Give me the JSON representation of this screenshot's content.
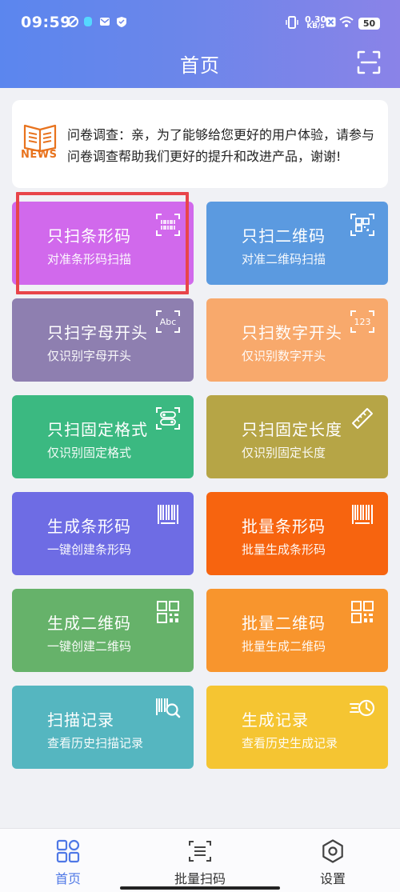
{
  "status_bar": {
    "time": "09:59",
    "network_speed_value": "0.30",
    "network_speed_unit": "KB/s",
    "battery": "50"
  },
  "header": {
    "title": "首页",
    "scan_icon": "scan-frame-icon"
  },
  "notice": {
    "icon_label": "NEWS",
    "text": "问卷调查：亲，为了能够给您更好的用户体验，请参与问卷调查帮助我们更好的提升和改进产品，谢谢!"
  },
  "cards": [
    {
      "title": "只扫条形码",
      "subtitle": "对准条形码扫描",
      "color": "#d169ec",
      "icon": "barcode-scan-icon"
    },
    {
      "title": "只扫二维码",
      "subtitle": "对准二维码扫描",
      "color": "#5b9ae0",
      "icon": "qrcode-scan-icon"
    },
    {
      "title": "只扫字母开头",
      "subtitle": "仅识别字母开头",
      "color": "#8e7fb0",
      "icon": "abc-scan-icon",
      "icon_text": "Abc"
    },
    {
      "title": "只扫数字开头",
      "subtitle": "仅识别数字开头",
      "color": "#f8a96c",
      "icon": "number-scan-icon",
      "icon_text": "123"
    },
    {
      "title": "只扫固定格式",
      "subtitle": "仅识别固定格式",
      "color": "#3bb981",
      "icon": "format-scan-icon"
    },
    {
      "title": "只扫固定长度",
      "subtitle": "仅识别固定长度",
      "color": "#b6a546",
      "icon": "ruler-icon"
    },
    {
      "title": "生成条形码",
      "subtitle": "一键创建条形码",
      "color": "#6e6ce4",
      "icon": "barcode-icon"
    },
    {
      "title": "批量条形码",
      "subtitle": "批量生成条形码",
      "color": "#f7640f",
      "icon": "barcode-icon"
    },
    {
      "title": "生成二维码",
      "subtitle": "一键创建二维码",
      "color": "#66b26a",
      "icon": "qrcode-icon"
    },
    {
      "title": "批量二维码",
      "subtitle": "批量生成二维码",
      "color": "#f8952d",
      "icon": "qrcode-icon"
    },
    {
      "title": "扫描记录",
      "subtitle": "查看历史扫描记录",
      "color": "#55b6c0",
      "icon": "scan-history-icon"
    },
    {
      "title": "生成记录",
      "subtitle": "查看历史生成记录",
      "color": "#f5c532",
      "icon": "generate-history-icon"
    }
  ],
  "bottom_nav": [
    {
      "label": "首页",
      "icon": "home-grid-icon",
      "active": true
    },
    {
      "label": "批量扫码",
      "icon": "batch-list-icon",
      "active": false
    },
    {
      "label": "设置",
      "icon": "settings-gear-icon",
      "active": false
    }
  ],
  "colors": {
    "header_start": "#5b86ee",
    "header_end": "#8a83e8",
    "active_tab": "#4f78e6",
    "news_accent": "#e8731e",
    "highlight_border": "#e8454a"
  }
}
